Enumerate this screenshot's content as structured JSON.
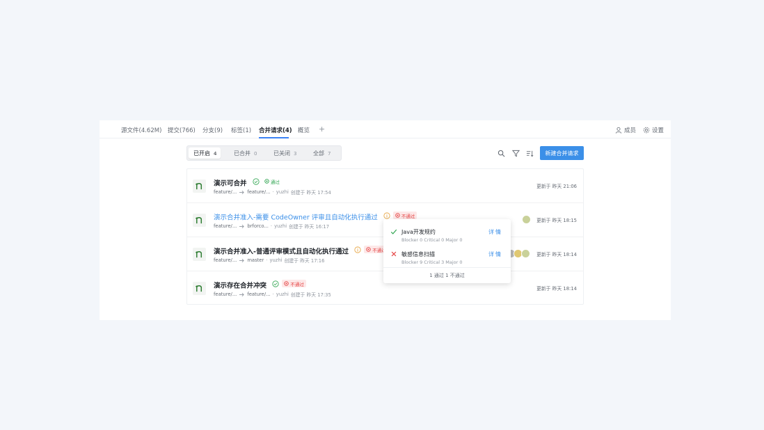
{
  "nav": {
    "tabs": [
      {
        "label": "源文件(4.62M)"
      },
      {
        "label": "提交(766)"
      },
      {
        "label": "分支(9)"
      },
      {
        "label": "标签(1)"
      },
      {
        "label": "合并请求(4)"
      },
      {
        "label": "概览"
      }
    ],
    "active_tab": "合并请求(4)",
    "add_label": "+",
    "members_label": "成员",
    "settings_label": "设置"
  },
  "filters": [
    {
      "label": "已开启",
      "count": "4"
    },
    {
      "label": "已合并",
      "count": "0"
    },
    {
      "label": "已关闭",
      "count": "3"
    },
    {
      "label": "全部",
      "count": "7"
    }
  ],
  "actions": {
    "new_mr_label": "新建合并请求"
  },
  "merge_requests": [
    {
      "title": "演示可合并",
      "status": "通过",
      "source": "feature/...",
      "target": "feature/...",
      "author": "yuzhi",
      "created": "创建于 昨天 17:54",
      "updated": "更新于 昨天 21:06"
    },
    {
      "title": "演示合并准入-需要 CodeOwner 评审且自动化执行通过",
      "status": "不通过",
      "source": "feature/...",
      "target": "brforco...",
      "author": "yuzhi",
      "created": "创建于 昨天 16:17",
      "updated": "更新于 昨天 18:15"
    },
    {
      "title": "演示合并准入-普通评审模式且自动化执行通过",
      "status": "不通过",
      "source": "feature/...",
      "target": "master",
      "author": "yuzhi",
      "created": "创建于 昨天 17:16",
      "updated": "更新于 昨天 18:14"
    },
    {
      "title": "演示存在合并冲突",
      "status": "不通过",
      "source": "feature/...",
      "target": "feature/...",
      "author": "yuzhi",
      "created": "创建于 昨天 17:35",
      "updated": "更新于 昨天 18:14"
    }
  ],
  "popover": {
    "items": [
      {
        "name": "Java开发规约",
        "stats": "Blocker 0   Critical 0   Major 0",
        "detail": "详情",
        "result": "pass"
      },
      {
        "name": "敏感信息扫描",
        "stats": "Blocker 9   Critical 3   Major 0",
        "detail": "详情",
        "result": "fail"
      }
    ],
    "summary": "1 通过 1 不通过"
  },
  "colors": {
    "accent": "#3b8fe8",
    "pass": "#2ea44f",
    "fail": "#e54545",
    "warning": "#e6a23c"
  }
}
